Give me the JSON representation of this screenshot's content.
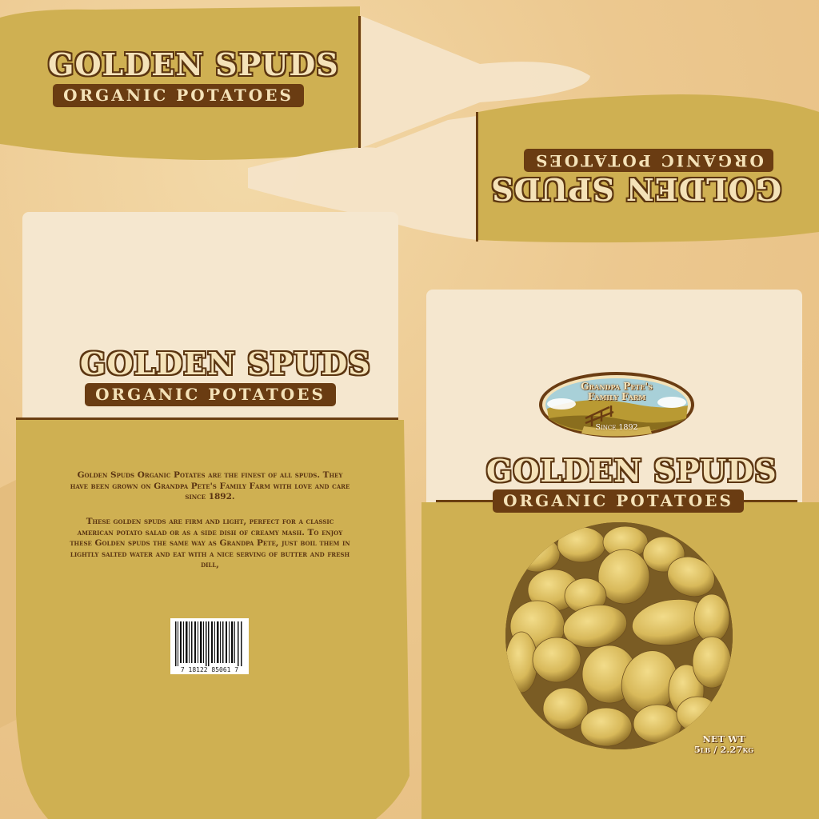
{
  "package": {
    "brand": "GOLDEN SPUDS",
    "product": "ORGANIC POTATOES"
  },
  "farm_logo": {
    "line1": "Grandpa Pete's",
    "line2": "Family Farm",
    "since": "Since 1892"
  },
  "description": {
    "paragraph1": "Golden Spuds Organic Potates are the finest of all spuds. They have been grown on Grandpa Pete's Family Farm with love and care since 1892.",
    "paragraph2": "These golden spuds are firm and light, perfect for a classic american potato salad or as a side dish of creamy mash. To enjoy these Golden spuds the same way as Grandpa Pete, just boil them in lightly salted water and eat with a nice serving of butter and fresh dill,"
  },
  "barcode": {
    "digits": "7   18122 85061   7"
  },
  "net_weight": {
    "label": "NET WT",
    "value": "5lb / 2.27kg"
  },
  "colors": {
    "kraft": "#ecc88f",
    "gold_panel": "#cfb052",
    "cream_panel": "#f5e7cf",
    "brown_accent": "#6a3c12"
  }
}
